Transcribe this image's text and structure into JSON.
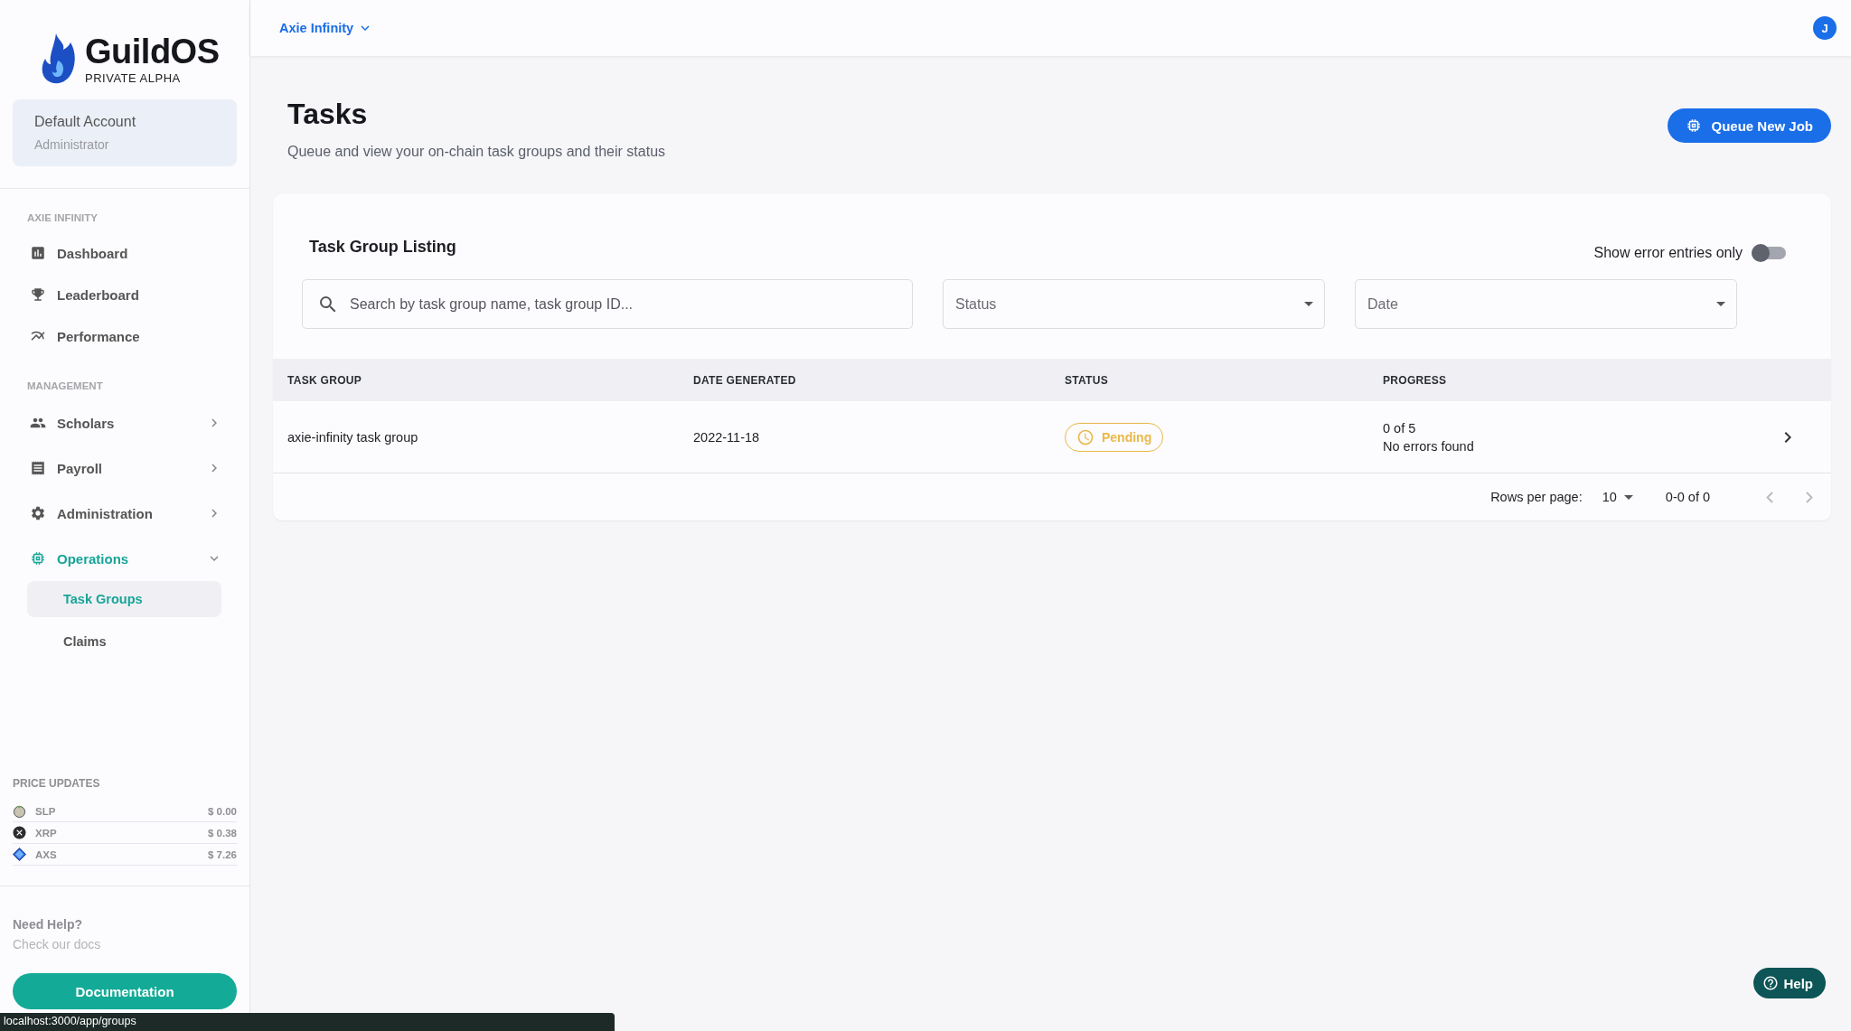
{
  "brand": {
    "name": "GuildOS",
    "subtitle": "PRIVATE ALPHA"
  },
  "account": {
    "name": "Default Account",
    "role": "Administrator"
  },
  "nav_sections": [
    {
      "title": "AXIE INFINITY",
      "items": [
        {
          "label": "Dashboard",
          "kind": "link",
          "selected": false
        },
        {
          "label": "Leaderboard",
          "kind": "link",
          "selected": false
        },
        {
          "label": "Performance",
          "kind": "link",
          "selected": false
        }
      ]
    },
    {
      "title": "MANAGEMENT",
      "items": [
        {
          "label": "Scholars",
          "kind": "group",
          "selected": false,
          "expanded": false
        },
        {
          "label": "Payroll",
          "kind": "group",
          "selected": false,
          "expanded": false
        },
        {
          "label": "Administration",
          "kind": "group",
          "selected": false,
          "expanded": false
        },
        {
          "label": "Operations",
          "kind": "group",
          "selected": true,
          "expanded": true,
          "children": [
            {
              "label": "Task Groups",
              "selected": true
            },
            {
              "label": "Claims",
              "selected": false
            }
          ]
        }
      ]
    }
  ],
  "price_updates": {
    "title": "PRICE UPDATES",
    "items": [
      {
        "symbol": "SLP",
        "price": "$ 0.00"
      },
      {
        "symbol": "XRP",
        "price": "$ 0.38"
      },
      {
        "symbol": "AXS",
        "price": "$ 7.26"
      }
    ]
  },
  "help_box": {
    "title": "Need Help?",
    "subtitle": "Check our docs",
    "button": "Documentation"
  },
  "topbar": {
    "project": "Axie Infinity",
    "avatar": "J"
  },
  "page": {
    "title": "Tasks",
    "subtitle": "Queue and view your on-chain task groups and their status",
    "action": "Queue New Job"
  },
  "listing": {
    "title": "Task Group Listing",
    "error_toggle": {
      "label": "Show error entries only",
      "on": false
    },
    "search": {
      "placeholder": "Search by task group name, task group ID..."
    },
    "filters": [
      {
        "placeholder": "Status"
      },
      {
        "placeholder": "Date"
      }
    ],
    "columns": [
      "TASK GROUP",
      "DATE GENERATED",
      "STATUS",
      "PROGRESS"
    ],
    "rows": [
      {
        "task_group": "axie-infinity task group",
        "date": "2022-11-18",
        "status": "Pending",
        "color": "#e9b949",
        "progress": "0 of 5",
        "errors": "No errors found"
      }
    ],
    "pagination": {
      "rows_per_page_label": "Rows per page:",
      "rows_per_page": "10",
      "range": "0-0 of 0"
    }
  },
  "help_button": "Help",
  "status_bar": {
    "url": "localhost:3000/app/groups"
  }
}
